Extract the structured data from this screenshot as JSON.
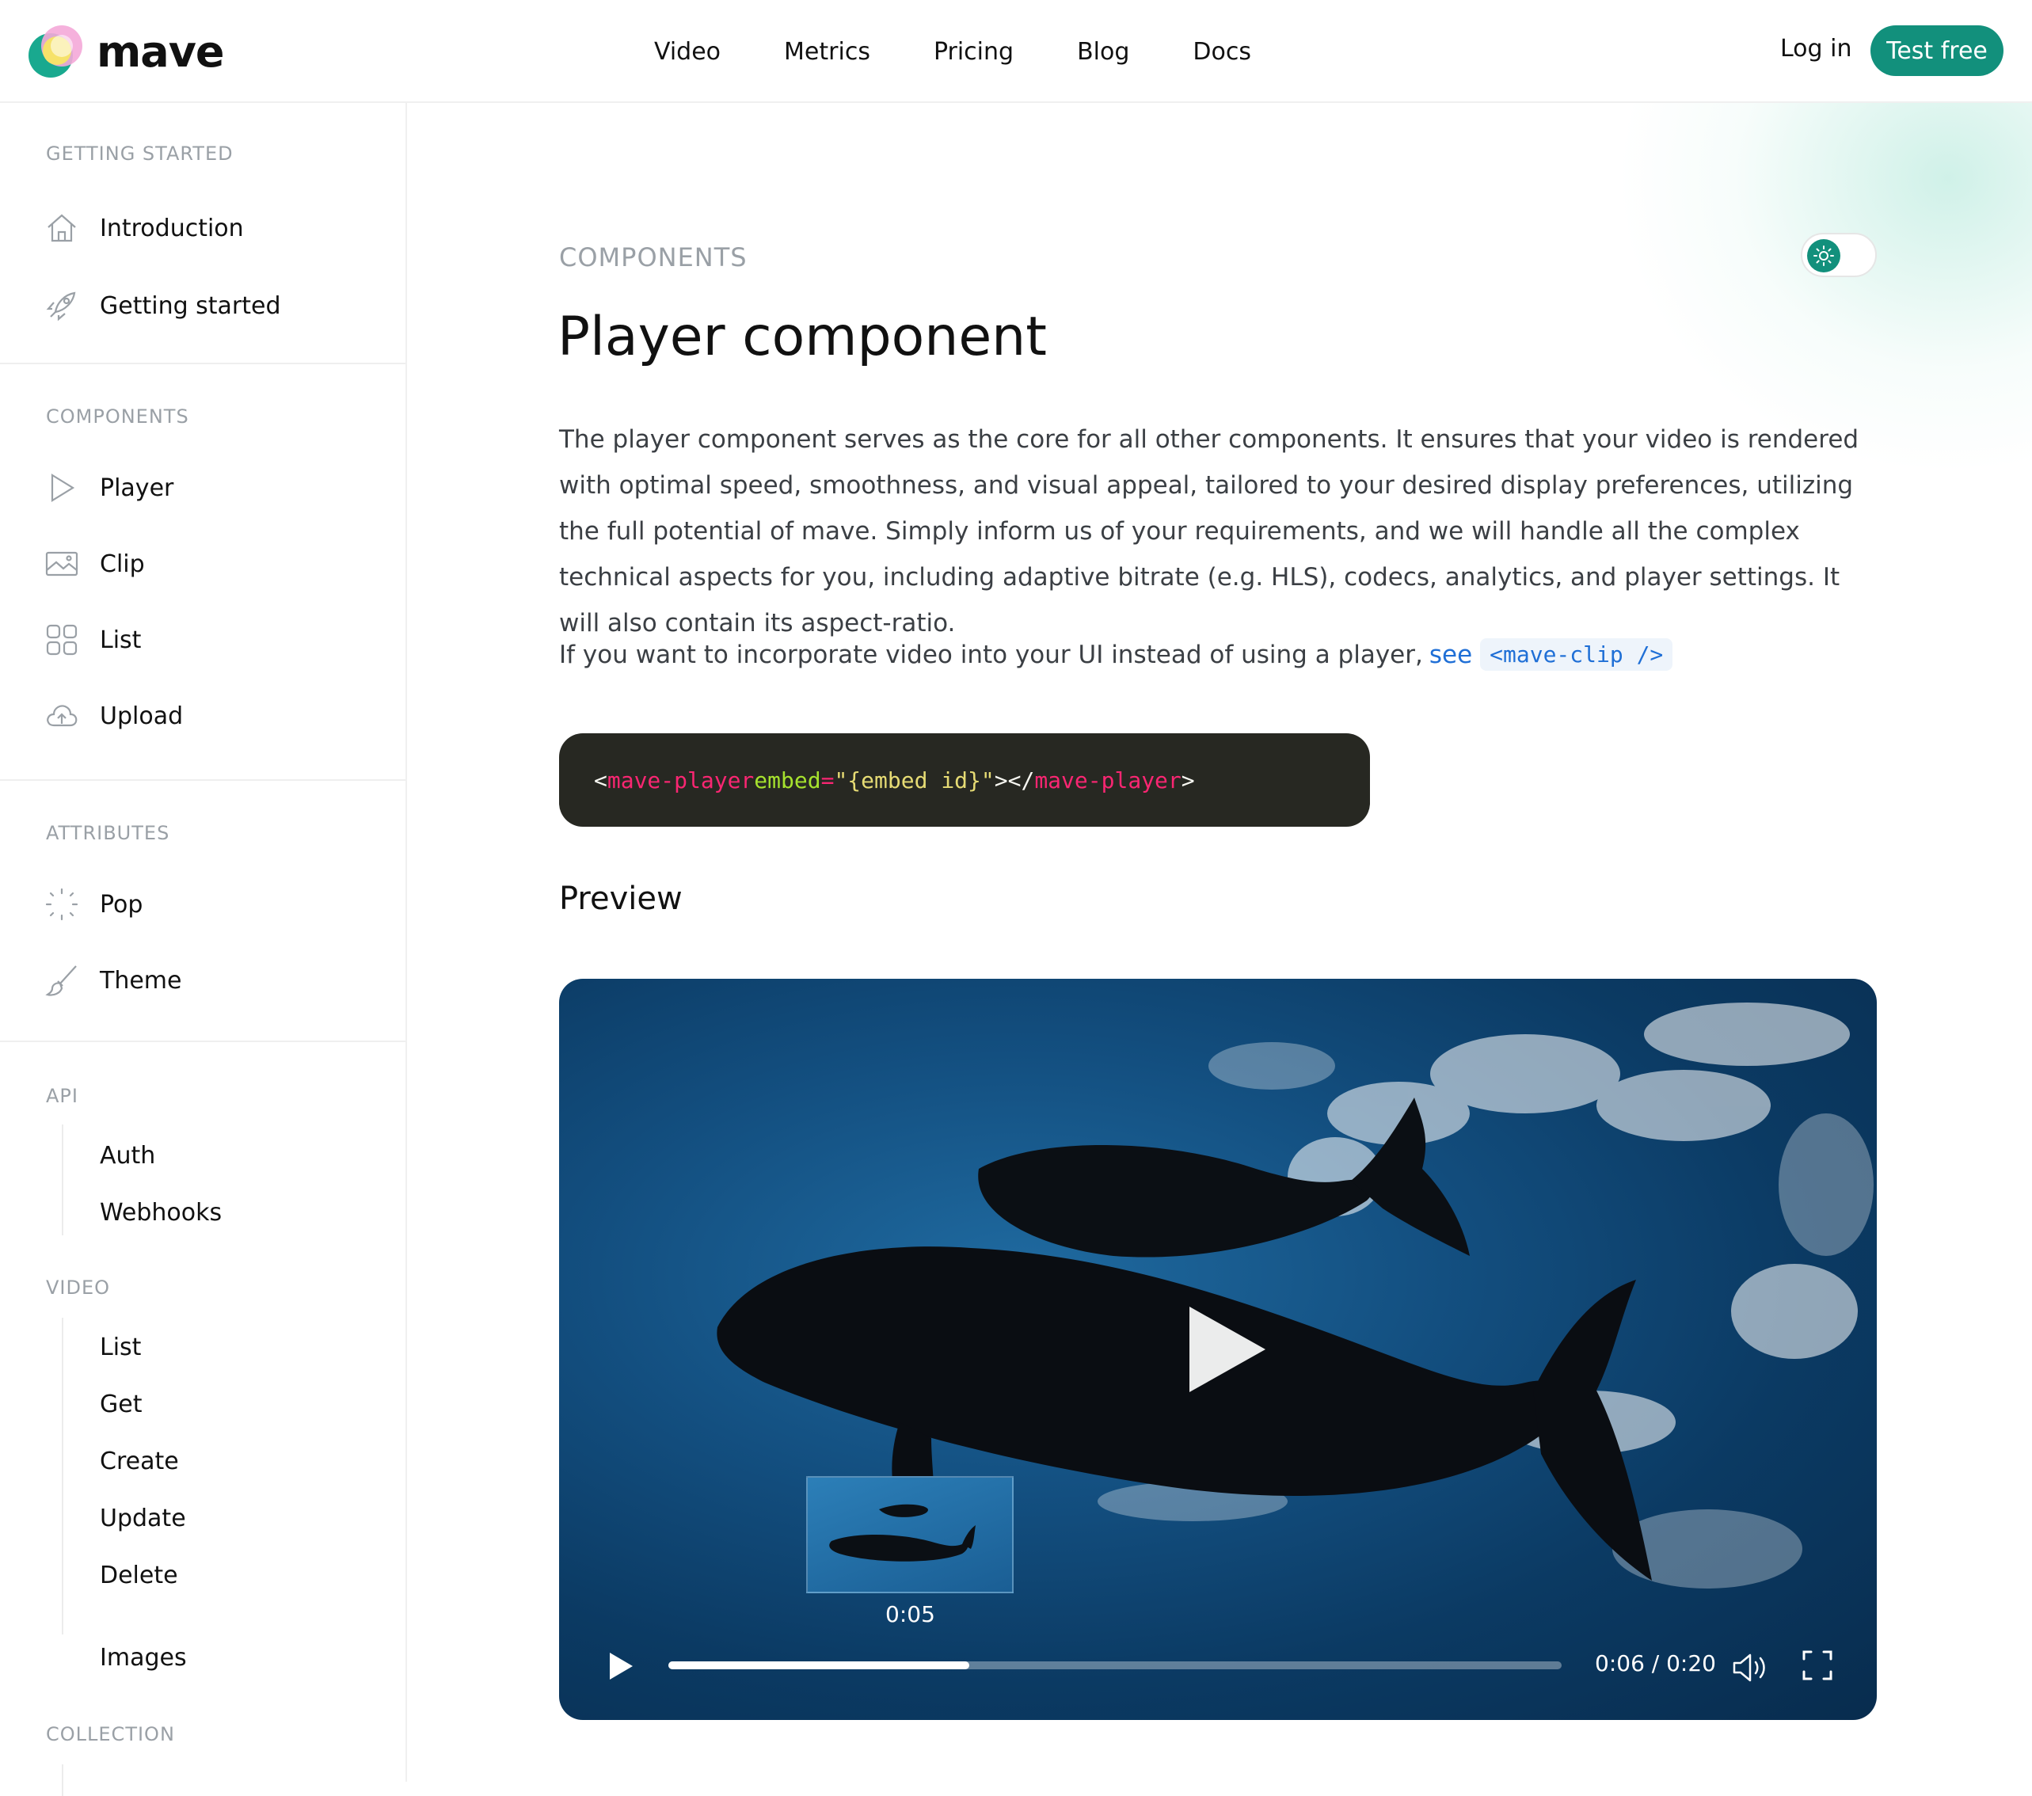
{
  "brand": {
    "name": "mave"
  },
  "nav": {
    "items": [
      "Video",
      "Metrics",
      "Pricing",
      "Blog",
      "Docs"
    ]
  },
  "header": {
    "login_label": "Log in",
    "cta_label": "Test free",
    "accent_color": "#12907c"
  },
  "sidebar": {
    "getting_started": {
      "title": "GETTING STARTED",
      "items": [
        {
          "label": "Introduction",
          "icon": "home-icon"
        },
        {
          "label": "Getting started",
          "icon": "rocket-icon"
        }
      ]
    },
    "components": {
      "title": "COMPONENTS",
      "items": [
        {
          "label": "Player",
          "icon": "play-outline-icon"
        },
        {
          "label": "Clip",
          "icon": "image-icon"
        },
        {
          "label": "List",
          "icon": "grid-icon"
        },
        {
          "label": "Upload",
          "icon": "cloud-upload-icon"
        }
      ]
    },
    "attributes": {
      "title": "ATTRIBUTES",
      "items": [
        {
          "label": "Pop",
          "icon": "loader-icon"
        },
        {
          "label": "Theme",
          "icon": "brush-icon"
        }
      ]
    },
    "api": {
      "title": "API",
      "items": [
        "Auth",
        "Webhooks"
      ]
    },
    "video": {
      "title": "VIDEO",
      "items": [
        "List",
        "Get",
        "Create",
        "Update",
        "Delete",
        "Images"
      ]
    },
    "collection": {
      "title": "COLLECTION"
    }
  },
  "main": {
    "eyebrow": "COMPONENTS",
    "title": "Player component",
    "description": "The player component serves as the core for all other components. It ensures that your video is rendered with optimal speed, smoothness, and visual appeal, tailored to your desired display preferences, utilizing the full potential of mave. Simply inform us of your requirements, and we will handle all the complex technical aspects for you, including adaptive bitrate (e.g. HLS), codecs, analytics, and player settings. It will also contain its aspect-ratio.",
    "note_text": "If you want to incorporate video into your UI instead of using a player,",
    "note_link": "see",
    "note_code": "<mave-clip />",
    "code": {
      "open_bracket": "<",
      "tag": "mave-player",
      "attr": "embed",
      "eq": "=",
      "value": "\"{embed id}\"",
      "mid": "></",
      "close_tag": "mave-player",
      "close_bracket": ">"
    },
    "preview_heading": "Preview",
    "theme_toggle": {
      "state": "light",
      "icon": "sun-icon"
    }
  },
  "player": {
    "hover_time": "0:05",
    "time_display": "0:06 / 0:20",
    "progress_fraction": 0.337
  }
}
